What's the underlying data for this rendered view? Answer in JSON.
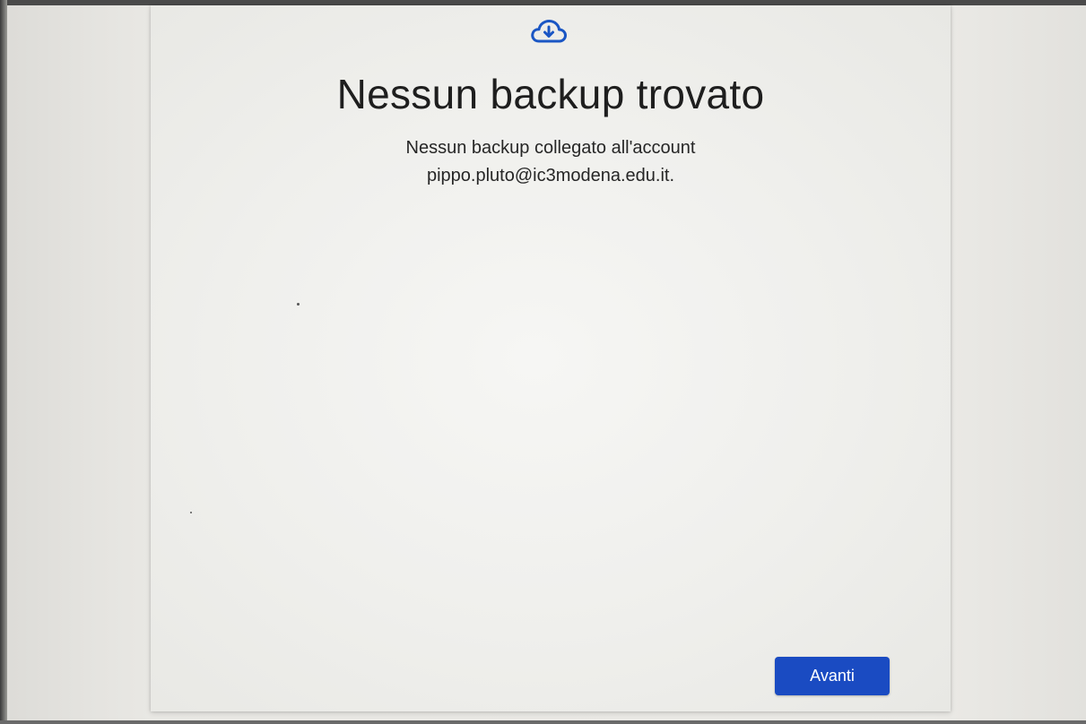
{
  "dialog": {
    "icon": "cloud-download-icon",
    "title": "Nessun backup trovato",
    "message_line1": "Nessun backup collegato all'account",
    "message_line2": "pippo.pluto@ic3modena.edu.it.",
    "next_button_label": "Avanti"
  },
  "colors": {
    "accent": "#1a4bc2",
    "icon": "#1a56c4",
    "background": "#f2f2ef"
  }
}
